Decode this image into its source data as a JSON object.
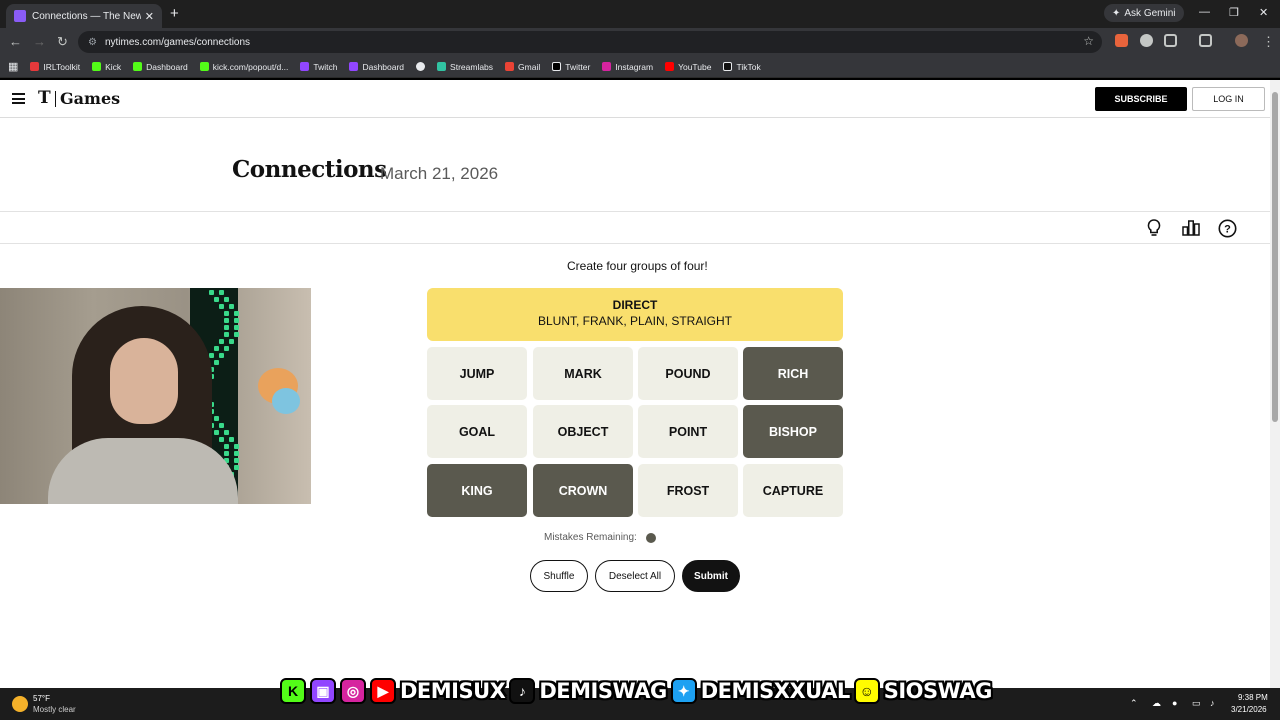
{
  "browser": {
    "tab_title": "Connections — The New York",
    "gemini_label": "Ask Gemini",
    "url": "nytimes.com/games/connections",
    "bookmarks": [
      "IRLToolkit",
      "Kick",
      "Dashboard",
      "kick.com/popout/d...",
      "Twitch",
      "Dashboard",
      "",
      "Streamlabs",
      "Gmail",
      "Twitter",
      "Instagram",
      "YouTube",
      "TikTok"
    ]
  },
  "header": {
    "logo_t": "T",
    "logo_games": "Games",
    "subscribe": "SUBSCRIBE",
    "login": "LOG IN"
  },
  "game": {
    "title": "Connections",
    "date": "March 21, 2026",
    "instructions": "Create four groups of four!",
    "solved": {
      "category": "DIRECT",
      "words": "BLUNT, FRANK, PLAIN, STRAIGHT",
      "color": "#f9df6d"
    },
    "tiles": [
      {
        "word": "JUMP",
        "selected": false
      },
      {
        "word": "MARK",
        "selected": false
      },
      {
        "word": "POUND",
        "selected": false
      },
      {
        "word": "RICH",
        "selected": true
      },
      {
        "word": "GOAL",
        "selected": false
      },
      {
        "word": "OBJECT",
        "selected": false
      },
      {
        "word": "POINT",
        "selected": false
      },
      {
        "word": "BISHOP",
        "selected": true
      },
      {
        "word": "KING",
        "selected": true
      },
      {
        "word": "CROWN",
        "selected": true
      },
      {
        "word": "FROST",
        "selected": false
      },
      {
        "word": "CAPTURE",
        "selected": false
      }
    ],
    "mistakes_label": "Mistakes Remaining:",
    "mistakes_remaining": 1,
    "buttons": {
      "shuffle": "Shuffle",
      "deselect": "Deselect All",
      "submit": "Submit"
    }
  },
  "taskbar": {
    "temp": "57°F",
    "weather": "Mostly clear",
    "time": "9:38 PM",
    "date": "3/21/2026"
  },
  "overlay": {
    "handles": [
      "DEMISUX",
      "DEMISWAG",
      "DEMISXXUAL",
      "SIOSWAG"
    ]
  },
  "colors": {
    "tile_unselected": "#efefe6",
    "tile_selected": "#5a594e",
    "yellow_group": "#f9df6d"
  }
}
